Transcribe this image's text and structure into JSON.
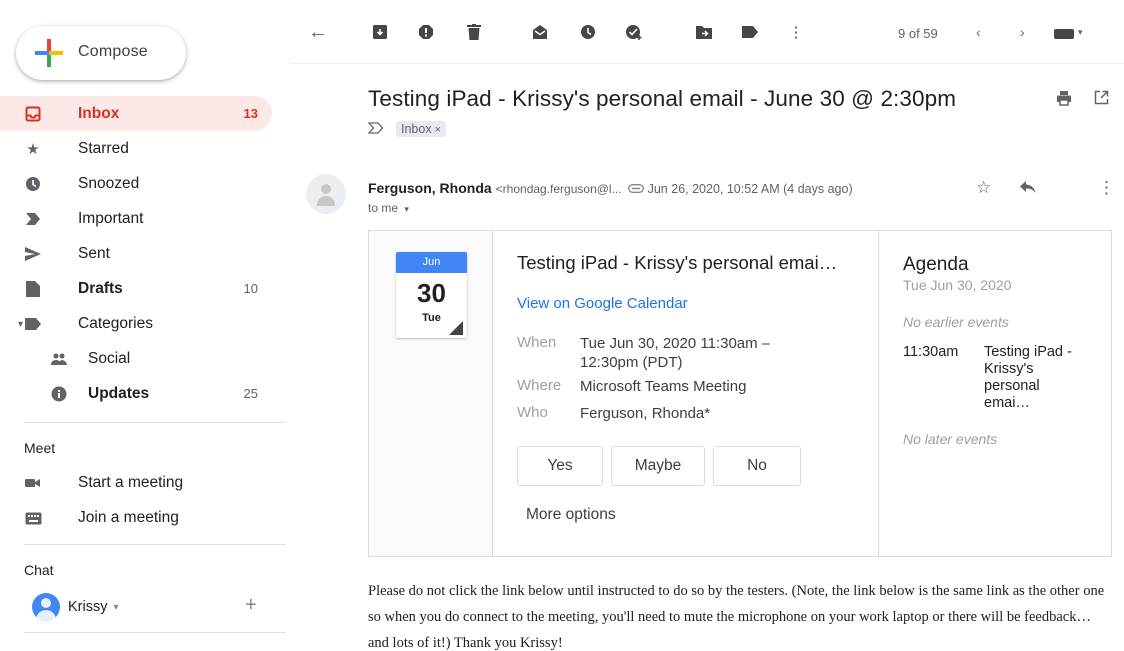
{
  "sidebar": {
    "compose_label": "Compose",
    "items": [
      {
        "label": "Inbox",
        "count": "13"
      },
      {
        "label": "Starred",
        "count": ""
      },
      {
        "label": "Snoozed",
        "count": ""
      },
      {
        "label": "Important",
        "count": ""
      },
      {
        "label": "Sent",
        "count": ""
      },
      {
        "label": "Drafts",
        "count": "10"
      },
      {
        "label": "Categories",
        "count": ""
      },
      {
        "label": "Social",
        "count": ""
      },
      {
        "label": "Updates",
        "count": "25"
      }
    ],
    "meet": {
      "title": "Meet",
      "start": "Start a meeting",
      "join": "Join a meeting"
    },
    "chat": {
      "title": "Chat",
      "user": "Krissy",
      "dropdown": "▾",
      "add": "+"
    }
  },
  "toolbar": {
    "pager": "9 of 59",
    "icons": [
      "back-icon",
      "archive-icon",
      "report-spam-icon",
      "delete-icon",
      "mark-unread-icon",
      "snooze-icon",
      "add-to-tasks-icon",
      "move-to-icon",
      "labels-icon",
      "more-icon",
      "older-icon",
      "newer-icon",
      "input-tools-icon"
    ]
  },
  "message": {
    "subject": "Testing iPad - Krissy's personal email - June 30 @ 2:30pm",
    "label": "Inbox",
    "label_remove": "×",
    "sender_name": "Ferguson, Rhonda",
    "sender_email": "<rhondag.ferguson@l...",
    "date": "Jun 26, 2020, 10:52 AM (4 days ago)",
    "to": "to me",
    "body": "Please do not click the link below until instructed to do so by the testers.  (Note, the link below is the same link as the other one so when you do connect to the meeting, you'll need to mute the microphone on your work laptop or there will be feedback…and lots of it!)  Thank you Krissy!"
  },
  "invite": {
    "cal_month": "Jun",
    "cal_day": "30",
    "cal_dow": "Tue",
    "title": "Testing iPad - Krissy's personal emai…",
    "link": "View on Google Calendar",
    "when_label": "When",
    "when_value": "Tue Jun 30, 2020 11:30am – 12:30pm (PDT)",
    "where_label": "Where",
    "where_value": "Microsoft Teams Meeting",
    "who_label": "Who",
    "who_value": "Ferguson, Rhonda*",
    "rsvp_yes": "Yes",
    "rsvp_maybe": "Maybe",
    "rsvp_no": "No",
    "more_options": "More options"
  },
  "agenda": {
    "title": "Agenda",
    "date": "Tue Jun 30, 2020",
    "no_earlier": "No earlier events",
    "event_time": "11:30am",
    "event_name": "Testing iPad - Krissy's personal emai…",
    "no_later": "No later events"
  },
  "colors": {
    "accent_red": "#d93025",
    "active_bg": "#fce8e6",
    "link_blue": "#1a73e8",
    "calendar_blue": "#4285f4"
  }
}
